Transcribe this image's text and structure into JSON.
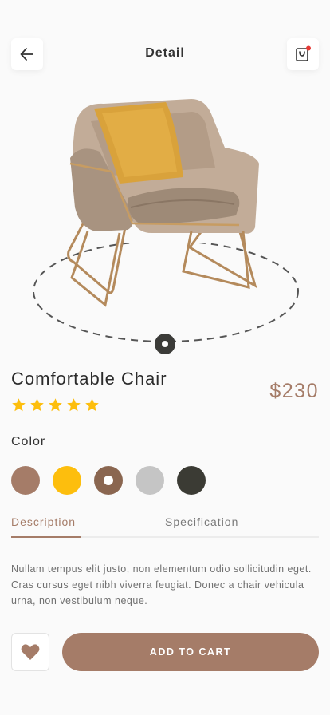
{
  "header": {
    "title": "Detail",
    "back_icon": "arrow-left-icon",
    "cart_icon": "shopping-bag-icon",
    "cart_has_notification": true
  },
  "product": {
    "name": "Comfortable Chair",
    "price": "$230",
    "rating": 5,
    "rating_max": 5
  },
  "color": {
    "label": "Color",
    "options": [
      "#a57c68",
      "#fdbe0d",
      "#8a6650",
      "#c5c5c5",
      "#3b3b34"
    ],
    "selected_index": 2
  },
  "tabs": {
    "items": [
      "Description",
      "Specification"
    ],
    "active_index": 0
  },
  "description": "Nullam tempus elit justo, non elementum odio sollicitudin eget. Cras cursus eget nibh viverra feugiat. Donec a chair vehicula urna, non vestibulum neque.",
  "actions": {
    "add_to_cart": "ADD TO CART",
    "favorite_icon": "heart-icon"
  },
  "colors": {
    "accent": "#a57c68",
    "star": "#fdbe0d",
    "notification": "#e53935"
  }
}
